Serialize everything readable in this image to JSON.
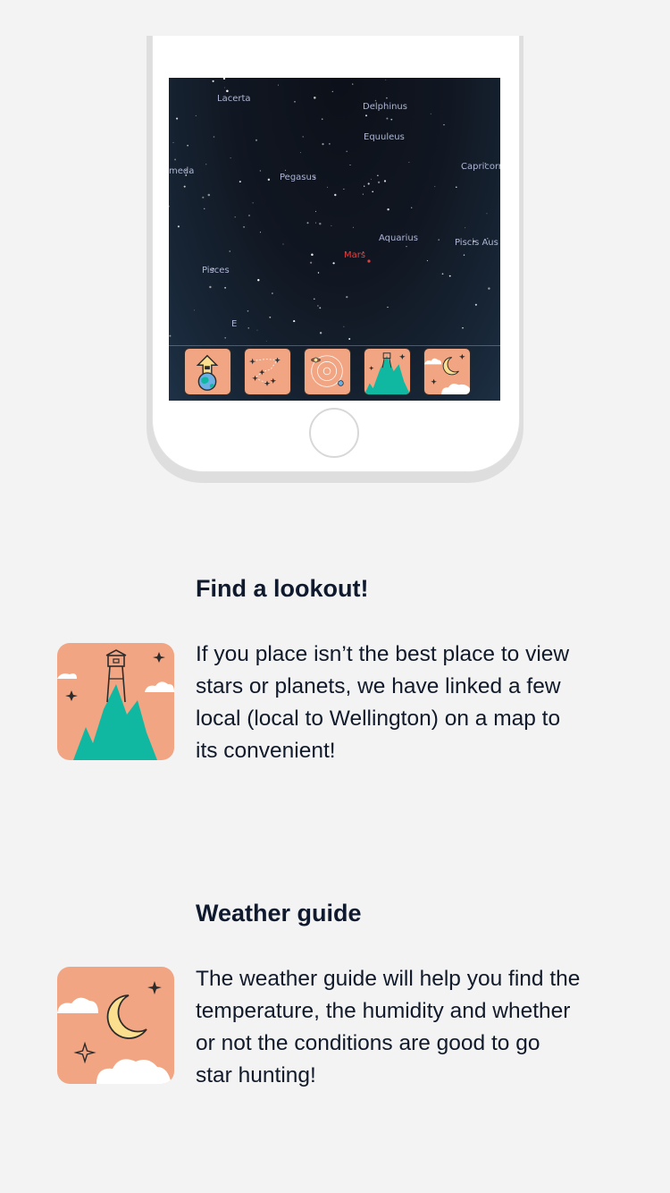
{
  "sky_view": {
    "constellations": [
      {
        "id": "lacerta",
        "label": "Lacerta"
      },
      {
        "id": "delphinus",
        "label": "Delphinus"
      },
      {
        "id": "equuleus",
        "label": "Equuleus"
      },
      {
        "id": "andromeda",
        "label": "meda"
      },
      {
        "id": "pegasus",
        "label": "Pegasus"
      },
      {
        "id": "capricornus",
        "label": "Capricorn"
      },
      {
        "id": "aquarius",
        "label": "Aquarius"
      },
      {
        "id": "piscis-austrinus",
        "label": "Piscis Aus"
      },
      {
        "id": "mars",
        "label": "Mars"
      },
      {
        "id": "pisces",
        "label": "Pisces"
      },
      {
        "id": "east",
        "label": "E"
      }
    ],
    "toolbar": [
      {
        "icon": "earth-location-icon"
      },
      {
        "icon": "constellation-icon"
      },
      {
        "icon": "solar-system-icon"
      },
      {
        "icon": "lookout-icon"
      },
      {
        "icon": "weather-icon"
      }
    ]
  },
  "features": [
    {
      "title": "Find a lookout!",
      "icon": "lookout-icon",
      "lines": [
        "If you place isn’t the best place to view",
        "stars or planets, we have linked a few",
        "local (local to Wellington) on a map to",
        "its convenient!"
      ]
    },
    {
      "title": "Weather guide",
      "icon": "weather-icon",
      "lines": [
        "The weather guide will help you find the",
        "temperature, the humidity and whether",
        "or not the conditions are good to go",
        "star hunting!"
      ]
    }
  ],
  "colors": {
    "background": "#f3f3f3",
    "icon_peach": "#f2a583",
    "mountain_teal": "#10b8a2",
    "moon_yellow": "#fcdf8e",
    "mars_red": "#e34040",
    "text_dark": "#0f1a2e"
  }
}
